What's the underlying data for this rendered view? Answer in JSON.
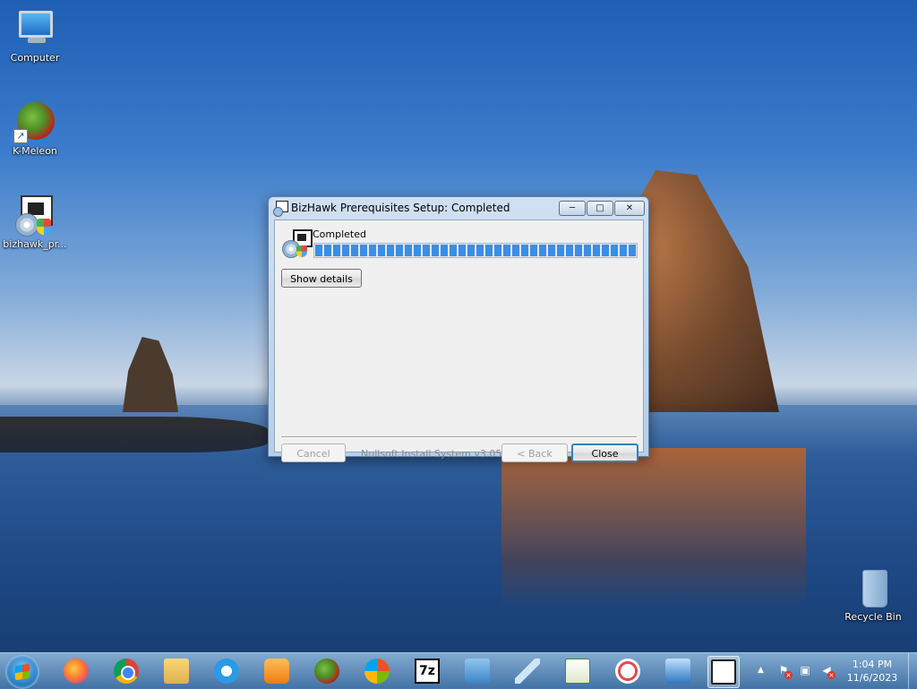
{
  "desktop": {
    "icons": [
      {
        "label": "Computer",
        "icon": "computer-icon"
      },
      {
        "label": "K-Meleon",
        "icon": "kmeleon-icon"
      },
      {
        "label": "bizhawk_pr...",
        "icon": "installer-icon"
      },
      {
        "label": "Recycle Bin",
        "icon": "recycle-bin-icon"
      }
    ]
  },
  "dialog": {
    "title": "BizHawk Prerequisites Setup: Completed",
    "titlebar_buttons": {
      "minimize": "─",
      "maximize": "□",
      "close": "✕"
    },
    "status_text": "Completed",
    "progress": 1.0,
    "show_details_label": "Show details",
    "cancel_label": "Cancel",
    "branding": "Nullsoft Install System v3.05",
    "back_label": "< Back",
    "close_label": "Close"
  },
  "taskbar": {
    "apps": [
      "Firefox",
      "Google Chrome",
      "Windows Explorer",
      "Internet Explorer",
      "Windows Media Player",
      "K-Meleon",
      "Windows",
      "7-Zip",
      "Control Panel",
      "Plane",
      "Chart",
      "Snipping Tool",
      "Network",
      "BizHawk Prerequisites Setup"
    ],
    "seven_zip_text": "7z",
    "tray_arrow": "▲",
    "tray_flag": "⚑",
    "tray_network": "▣",
    "tray_volume": "◀",
    "tray_x": "×",
    "time": "1:04 PM",
    "date": "11/6/2023"
  },
  "colors": {
    "progress_fill": "#3a8ee6",
    "taskbar": "#5a8cc0"
  }
}
